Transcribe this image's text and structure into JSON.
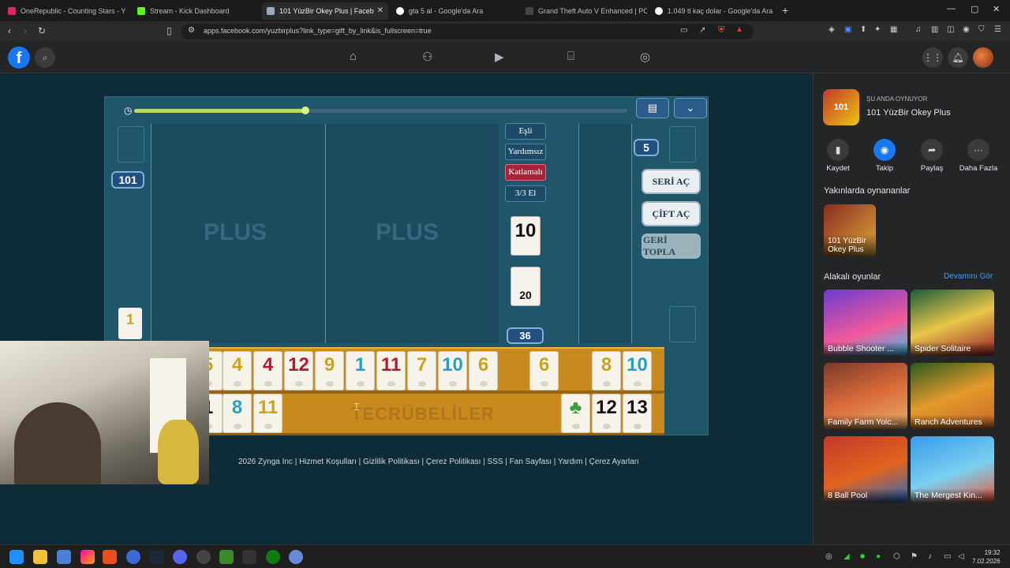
{
  "browser": {
    "tabs": [
      {
        "label": "OneRepublic - Counting Stars - Y",
        "color": "#e0245e"
      },
      {
        "label": "Stream - Kick Dashboard",
        "color": "#53fc18"
      },
      {
        "label": "101 YüzBir Okey Plus | Faceb",
        "color": "#c0c0c0"
      },
      {
        "label": "gta 5 al - Google'da Ara",
        "color": "#ffffff"
      },
      {
        "label": "Grand Theft Auto V Enhanced | PC iç",
        "color": "#2d2d2d"
      },
      {
        "label": "1.049 tl kaç dolar - Google'da Ara",
        "color": "#ffffff"
      }
    ],
    "url": "apps.facebook.com/yuzbirplus?link_type=gift_by_link&is_fullscreen=true"
  },
  "facebook": {
    "logo": "f"
  },
  "game": {
    "rules": [
      "Eşli",
      "Yardımsız",
      "Katlamalı",
      "3/3 El"
    ],
    "left_badge": "101",
    "right_badge": "5",
    "indicator_tile": "10",
    "draw_tile": "20",
    "side_tile": "1",
    "remaining": "36",
    "buttons": [
      "SERİ AÇ",
      "ÇİFT AÇ",
      "GERİ TOPLA"
    ],
    "rack_label": "TECRÜBELİLER",
    "rack_top": [
      "5",
      "4",
      "4",
      "12",
      "9",
      "1",
      "11",
      "7",
      "10",
      "6",
      "6",
      "8",
      "10"
    ],
    "rack_bottom": [
      "1",
      "8",
      "11",
      "♣",
      "12",
      "13"
    ],
    "footer": "2026 Zynga Inc | Hizmet Koşulları | Gizlilik Politikası | Çerez Politikası | SSS | Fan Sayfası | Yardım | Çerez Ayarları"
  },
  "sidebar": {
    "now_playing_label": "ŞU ANDA OYNUYOR",
    "game_name": "101 YüzBir Okey Plus",
    "game_icon_text": "101",
    "actions": [
      "Kaydet",
      "Takip",
      "Paylaş",
      "Daha Fazla"
    ],
    "recent_title": "Yakınlarda oynananlar",
    "recent_game": "101 YüzBir Okey Plus",
    "related_title": "Alakalı oyunlar",
    "see_more": "Devamını Gör",
    "related": [
      "Bubble Shooter ...",
      "Spider Solitaire",
      "Family Farm Yolc...",
      "Ranch Adventures",
      "8 Ball Pool",
      "The Mergest Kin..."
    ]
  },
  "taskbar": {
    "time": "19:32",
    "date": "7.02.2026"
  },
  "colors": {
    "yellow": "#c9a51f",
    "red": "#b8182f",
    "blue": "#27a0c8",
    "black": "#111111",
    "fb_blue": "#1877f2"
  }
}
